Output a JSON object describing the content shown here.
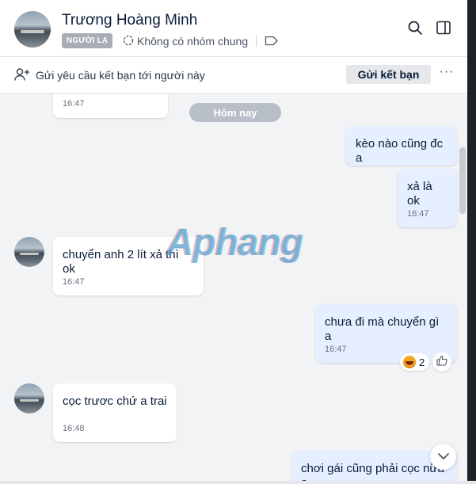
{
  "header": {
    "contact_name": "Trương Hoàng Minh",
    "stranger_badge": "NGƯỜI LẠ",
    "no_common_group": "Không có nhóm chung"
  },
  "friend_bar": {
    "request_text": "Gửi yêu cầu kết bạn tới người này",
    "send_button": "Gửi kết bạn",
    "more_label": "···"
  },
  "chat": {
    "date_separator": "Hôm nay",
    "messages": [
      {
        "direction": "in",
        "text": "",
        "time": "16:47"
      },
      {
        "direction": "out",
        "text": "kèo nào cũng đc a",
        "time": ""
      },
      {
        "direction": "out",
        "text": "xả là ok",
        "time": "16:47"
      },
      {
        "direction": "in",
        "text": "chuyển anh 2 lít xả thì ok",
        "time": "16:47"
      },
      {
        "direction": "out",
        "text": "chưa đi mà chuyển gì a",
        "time": "16:47",
        "reaction_count": "2"
      },
      {
        "direction": "in",
        "text": "cọc trươc chứ a trai",
        "time": "16:48"
      },
      {
        "direction": "out",
        "text": "chơi gái cũng phải cọc nữa a",
        "time": ""
      }
    ]
  },
  "watermark": "Aphang",
  "colors": {
    "incoming_bubble": "#ffffff",
    "outgoing_bubble": "#e5efff",
    "chat_background": "#f2f3f5"
  }
}
